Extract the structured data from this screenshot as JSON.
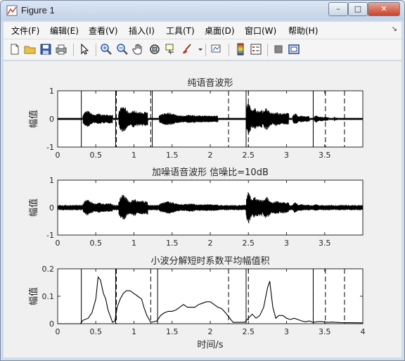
{
  "window": {
    "title": "Figure 1",
    "minimize": "–",
    "maximize": "□",
    "close": "✕"
  },
  "menu": [
    "文件(F)",
    "编辑(E)",
    "查看(V)",
    "插入(I)",
    "工具(T)",
    "桌面(D)",
    "窗口(W)",
    "帮助(H)"
  ],
  "toolbar_icons": [
    "new-figure-icon",
    "open-file-icon",
    "save-icon",
    "print-icon",
    "pointer-icon",
    "zoom-in-icon",
    "zoom-out-icon",
    "pan-hand-icon",
    "rotate-3d-icon",
    "data-cursor-icon",
    "brush-icon",
    "link-plot-icon",
    "colorbar-icon",
    "legend-icon",
    "hide-plot-tools-icon",
    "show-plot-tools-icon"
  ],
  "chart_data": [
    {
      "type": "line",
      "title": "纯语音波形",
      "xlabel": "",
      "ylabel": "幅值",
      "xlim": [
        0,
        4
      ],
      "ylim": [
        -1,
        1
      ],
      "yticks": [
        "1",
        "0",
        "-1"
      ],
      "xticks": [
        "0",
        "0.5",
        "1",
        "1.5",
        "2",
        "2.5",
        "3",
        "3.5"
      ],
      "series": [
        {
          "description": "clean speech waveform, bursts",
          "segments": [
            {
              "x": [
                0.33,
                0.72
              ],
              "amp": 0.45
            },
            {
              "x": [
                0.8,
                1.18
              ],
              "amp": 0.72
            },
            {
              "x": [
                1.33,
                2.1
              ],
              "amp": 0.35
            },
            {
              "x": [
                2.47,
                2.68
              ],
              "amp": 0.9
            },
            {
              "x": [
                2.68,
                3.03
              ],
              "amp": 0.6
            },
            {
              "x": [
                3.08,
                3.3
              ],
              "amp": 0.3
            },
            {
              "x": [
                3.36,
                3.55
              ],
              "amp": 0.2
            },
            {
              "x": [
                3.62,
                3.68
              ],
              "amp": 0.12
            }
          ]
        }
      ],
      "solid_lines": [
        0.31,
        0.76,
        1.24,
        2.47,
        3.35
      ],
      "dashed_lines": [
        0.77,
        1.22,
        2.24,
        2.5,
        3.35,
        3.51,
        3.76
      ]
    },
    {
      "type": "line",
      "title": "加噪语音波形 信噪比=10dB",
      "xlabel": "",
      "ylabel": "幅值",
      "xlim": [
        0,
        4
      ],
      "ylim": [
        -1,
        1
      ],
      "yticks": [
        "1",
        "0",
        "-1"
      ],
      "xticks": [
        "0",
        "0.5",
        "1",
        "1.5",
        "2",
        "2.5",
        "3",
        "3.5"
      ],
      "noise_amp": 0.1,
      "series": [
        {
          "description": "noisy speech waveform, bursts",
          "segments": [
            {
              "x": [
                0.33,
                0.72
              ],
              "amp": 0.45
            },
            {
              "x": [
                0.8,
                1.18
              ],
              "amp": 0.72
            },
            {
              "x": [
                1.33,
                2.1
              ],
              "amp": 0.35
            },
            {
              "x": [
                2.47,
                2.68
              ],
              "amp": 0.9
            },
            {
              "x": [
                2.68,
                3.03
              ],
              "amp": 0.6
            },
            {
              "x": [
                3.08,
                3.3
              ],
              "amp": 0.3
            },
            {
              "x": [
                3.36,
                3.55
              ],
              "amp": 0.2
            },
            {
              "x": [
                3.62,
                3.68
              ],
              "amp": 0.12
            }
          ]
        }
      ]
    },
    {
      "type": "line",
      "title": "小波分解短时系数平均幅值积",
      "xlabel": "时间/s",
      "ylabel": "幅值",
      "xlim": [
        0,
        4
      ],
      "ylim": [
        0,
        0.2
      ],
      "yticks": [
        "0.2",
        "0.1",
        "0"
      ],
      "xticks": [
        "0",
        "0.5",
        "1",
        "1.5",
        "2",
        "2.5",
        "3",
        "3.5",
        "4"
      ],
      "series": [
        {
          "x": [
            0,
            0.3,
            0.33,
            0.4,
            0.45,
            0.5,
            0.53,
            0.56,
            0.6,
            0.63,
            0.66,
            0.7,
            0.72,
            0.75,
            0.78,
            0.82,
            0.86,
            0.9,
            0.95,
            1.0,
            1.05,
            1.1,
            1.13,
            1.17,
            1.22,
            1.3,
            1.35,
            1.4,
            1.45,
            1.5,
            1.55,
            1.6,
            1.65,
            1.7,
            1.75,
            1.8,
            1.85,
            1.9,
            1.95,
            2.0,
            2.05,
            2.1,
            2.15,
            2.2,
            2.3,
            2.45,
            2.5,
            2.55,
            2.6,
            2.65,
            2.7,
            2.75,
            2.78,
            2.82,
            2.86,
            2.9,
            2.95,
            3.0,
            3.05,
            3.1,
            3.15,
            3.2,
            3.25,
            3.3,
            3.35,
            3.4,
            3.45,
            3.5,
            3.55,
            3.6,
            3.65,
            3.7,
            4.0
          ],
          "y": [
            0,
            0,
            0.012,
            0.02,
            0.04,
            0.09,
            0.17,
            0.16,
            0.11,
            0.09,
            0.05,
            0.02,
            0.005,
            0.01,
            0.06,
            0.09,
            0.11,
            0.12,
            0.12,
            0.11,
            0.1,
            0.09,
            0.06,
            0.03,
            0.005,
            0.01,
            0.03,
            0.04,
            0.045,
            0.045,
            0.05,
            0.06,
            0.07,
            0.06,
            0.06,
            0.06,
            0.07,
            0.075,
            0.08,
            0.08,
            0.07,
            0.06,
            0.055,
            0.04,
            0.005,
            0.005,
            0.02,
            0.035,
            0.02,
            0.03,
            0.06,
            0.13,
            0.155,
            0.06,
            0.02,
            0.03,
            0.03,
            0.02,
            0.015,
            0.02,
            0.015,
            0.01,
            0.007,
            0.01,
            0.005,
            0.007,
            0.008,
            0.006,
            0.005,
            0.006,
            0.005,
            0.004,
            0.003
          ]
        }
      ],
      "solid_lines": [
        0.31,
        0.76,
        1.31,
        2.47,
        3.35
      ],
      "dashed_lines": [
        0.77,
        1.22,
        2.24,
        2.5,
        3.35,
        3.51,
        3.76
      ]
    }
  ]
}
